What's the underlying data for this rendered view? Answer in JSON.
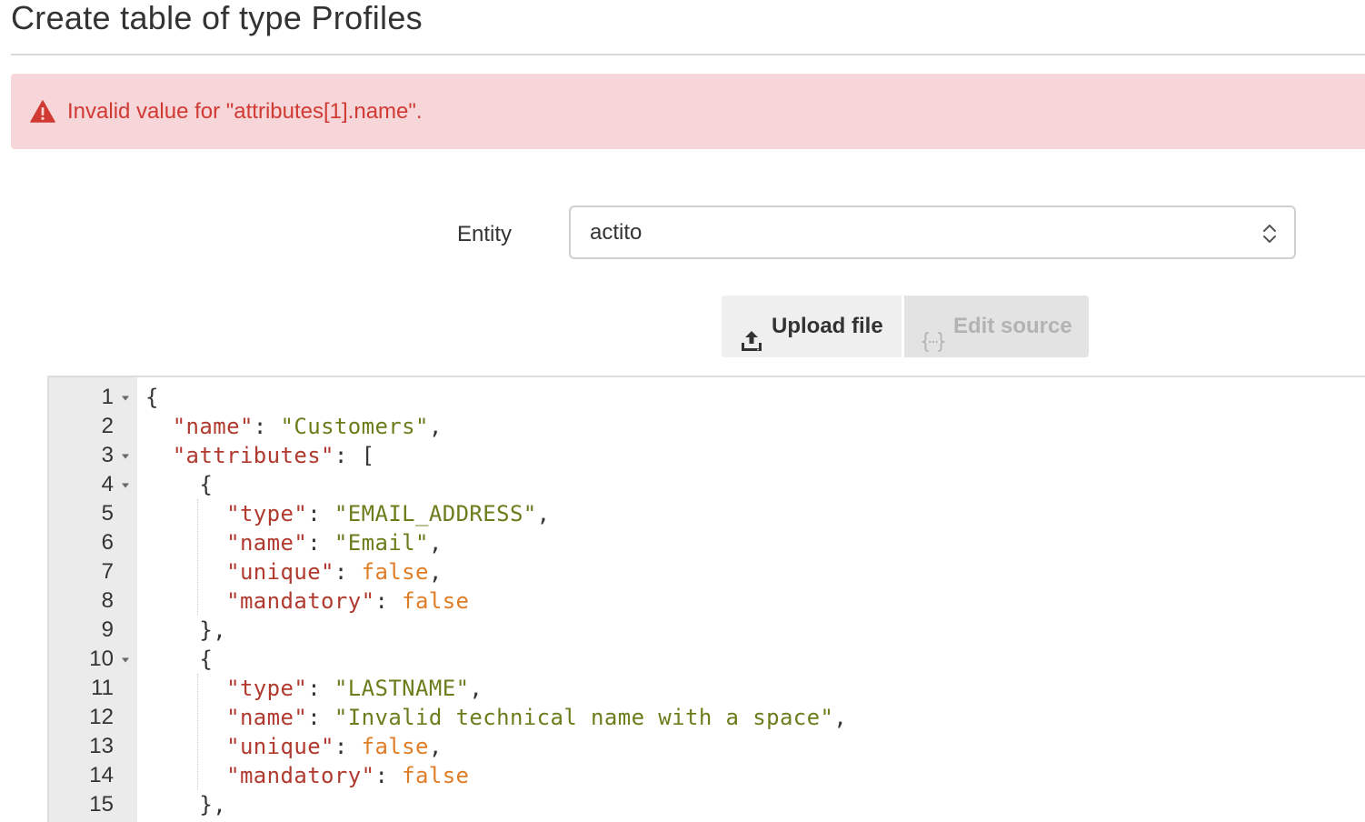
{
  "page": {
    "title": "Create table of type Profiles"
  },
  "alert": {
    "icon": "warning-icon",
    "message": "Invalid value for \"attributes[1].name\".",
    "color": "#d03a33",
    "background": "#f6d6d8"
  },
  "form": {
    "entity_label": "Entity",
    "entity_value": "actito"
  },
  "toolbar": {
    "upload_label": "Upload file",
    "upload_icon": "upload-icon",
    "edit_source_label": "Edit source",
    "edit_source_icon": "braces-icon"
  },
  "editor": {
    "lines": [
      {
        "num": "1",
        "fold": true,
        "tokens": [
          {
            "t": "{",
            "c": "punc"
          }
        ]
      },
      {
        "num": "2",
        "fold": false,
        "tokens": [
          {
            "t": "  ",
            "c": "punc"
          },
          {
            "t": "\"name\"",
            "c": "key"
          },
          {
            "t": ": ",
            "c": "punc"
          },
          {
            "t": "\"Customers\"",
            "c": "str"
          },
          {
            "t": ",",
            "c": "punc"
          }
        ]
      },
      {
        "num": "3",
        "fold": true,
        "tokens": [
          {
            "t": "  ",
            "c": "punc"
          },
          {
            "t": "\"attributes\"",
            "c": "key"
          },
          {
            "t": ": [",
            "c": "punc"
          }
        ]
      },
      {
        "num": "4",
        "fold": true,
        "tokens": [
          {
            "t": "    {",
            "c": "punc"
          }
        ]
      },
      {
        "num": "5",
        "fold": false,
        "tokens": [
          {
            "t": "      ",
            "c": "punc"
          },
          {
            "t": "\"type\"",
            "c": "key"
          },
          {
            "t": ": ",
            "c": "punc"
          },
          {
            "t": "\"EMAIL_ADDRESS\"",
            "c": "str"
          },
          {
            "t": ",",
            "c": "punc"
          }
        ]
      },
      {
        "num": "6",
        "fold": false,
        "tokens": [
          {
            "t": "      ",
            "c": "punc"
          },
          {
            "t": "\"name\"",
            "c": "key"
          },
          {
            "t": ": ",
            "c": "punc"
          },
          {
            "t": "\"Email\"",
            "c": "str"
          },
          {
            "t": ",",
            "c": "punc"
          }
        ]
      },
      {
        "num": "7",
        "fold": false,
        "tokens": [
          {
            "t": "      ",
            "c": "punc"
          },
          {
            "t": "\"unique\"",
            "c": "key"
          },
          {
            "t": ": ",
            "c": "punc"
          },
          {
            "t": "false",
            "c": "bool"
          },
          {
            "t": ",",
            "c": "punc"
          }
        ]
      },
      {
        "num": "8",
        "fold": false,
        "tokens": [
          {
            "t": "      ",
            "c": "punc"
          },
          {
            "t": "\"mandatory\"",
            "c": "key"
          },
          {
            "t": ": ",
            "c": "punc"
          },
          {
            "t": "false",
            "c": "bool"
          }
        ]
      },
      {
        "num": "9",
        "fold": false,
        "tokens": [
          {
            "t": "    },",
            "c": "punc"
          }
        ]
      },
      {
        "num": "10",
        "fold": true,
        "tokens": [
          {
            "t": "    {",
            "c": "punc"
          }
        ]
      },
      {
        "num": "11",
        "fold": false,
        "tokens": [
          {
            "t": "      ",
            "c": "punc"
          },
          {
            "t": "\"type\"",
            "c": "key"
          },
          {
            "t": ": ",
            "c": "punc"
          },
          {
            "t": "\"LASTNAME\"",
            "c": "str"
          },
          {
            "t": ",",
            "c": "punc"
          }
        ]
      },
      {
        "num": "12",
        "fold": false,
        "tokens": [
          {
            "t": "      ",
            "c": "punc"
          },
          {
            "t": "\"name\"",
            "c": "key"
          },
          {
            "t": ": ",
            "c": "punc"
          },
          {
            "t": "\"Invalid technical name with a space\"",
            "c": "str"
          },
          {
            "t": ",",
            "c": "punc"
          }
        ]
      },
      {
        "num": "13",
        "fold": false,
        "tokens": [
          {
            "t": "      ",
            "c": "punc"
          },
          {
            "t": "\"unique\"",
            "c": "key"
          },
          {
            "t": ": ",
            "c": "punc"
          },
          {
            "t": "false",
            "c": "bool"
          },
          {
            "t": ",",
            "c": "punc"
          }
        ]
      },
      {
        "num": "14",
        "fold": false,
        "tokens": [
          {
            "t": "      ",
            "c": "punc"
          },
          {
            "t": "\"mandatory\"",
            "c": "key"
          },
          {
            "t": ": ",
            "c": "punc"
          },
          {
            "t": "false",
            "c": "bool"
          }
        ]
      },
      {
        "num": "15",
        "fold": false,
        "tokens": [
          {
            "t": "    },",
            "c": "punc"
          }
        ]
      }
    ]
  }
}
